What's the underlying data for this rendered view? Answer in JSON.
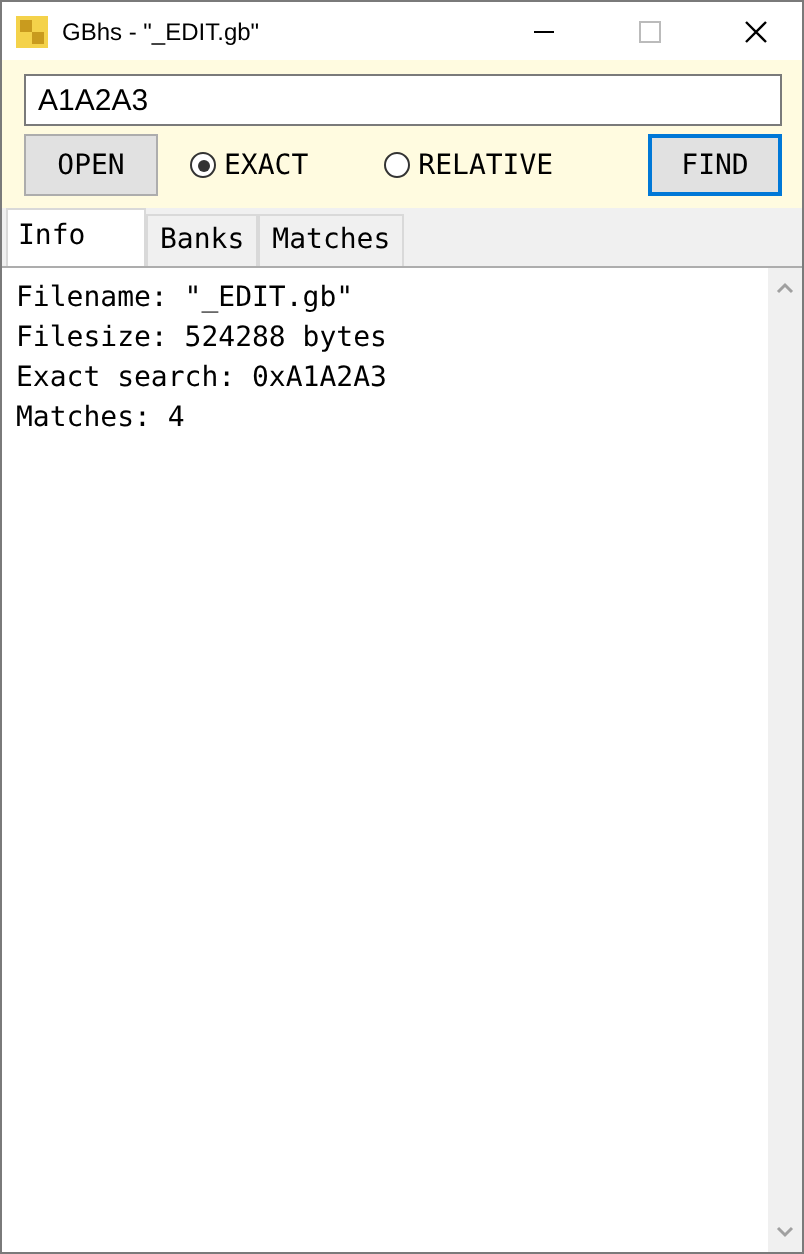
{
  "window": {
    "title": "GBhs - \"_EDIT.gb\""
  },
  "search": {
    "value": "A1A2A3"
  },
  "buttons": [
    {
      "label": "OPEN",
      "focused": false
    },
    {
      "label": "FIND",
      "focused": true
    }
  ],
  "modes": [
    {
      "label": "EXACT",
      "selected": true
    },
    {
      "label": "RELATIVE",
      "selected": false
    }
  ],
  "tabs": [
    {
      "label": "Info",
      "selected": true
    },
    {
      "label": "Banks",
      "selected": false
    },
    {
      "label": "Matches",
      "selected": false
    }
  ],
  "output": [
    "Filename: \"_EDIT.gb\"",
    "Filesize: 524288 bytes",
    "Exact search: 0xA1A2A3",
    "Matches: 4"
  ]
}
